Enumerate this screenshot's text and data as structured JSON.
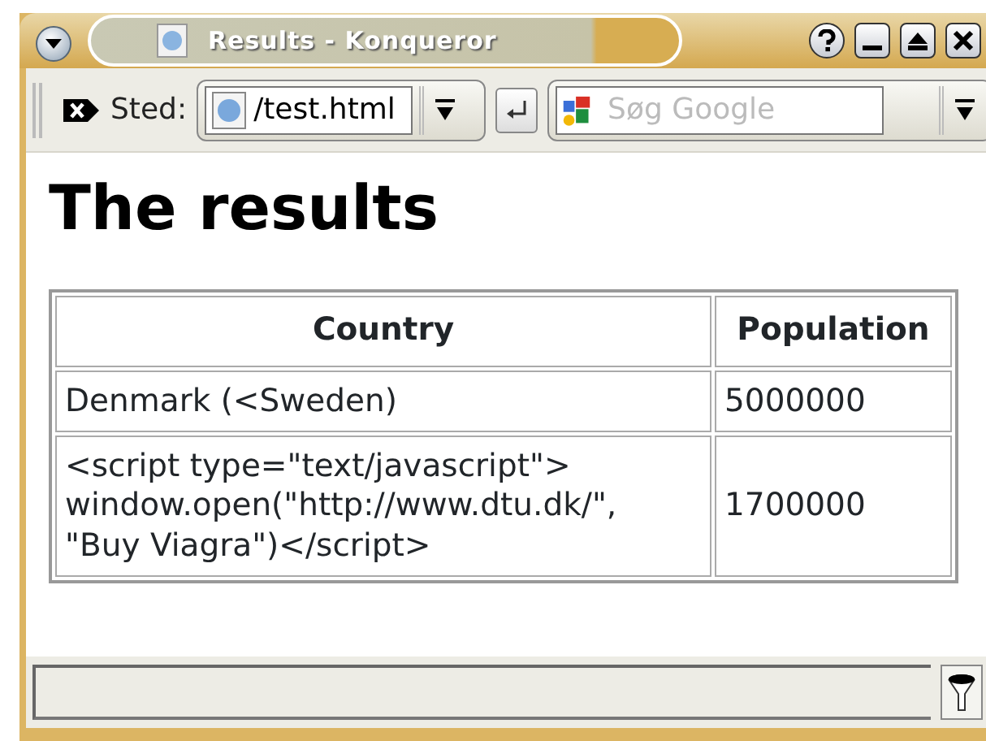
{
  "window": {
    "title": "Results - Konqueror"
  },
  "toolbar": {
    "location_label": "Sted:",
    "location_value": "/test.html",
    "search_placeholder": "Søg Google"
  },
  "page": {
    "heading": "The results",
    "table": {
      "columns": [
        "Country",
        "Population"
      ],
      "rows": [
        [
          "Denmark (<Sweden)",
          "5000000"
        ],
        [
          "<script type=\"text/javascript\">\nwindow.open(\"http://www.dtu.dk/\",\n\"Buy Viagra\")</script>",
          "1700000"
        ]
      ]
    }
  }
}
